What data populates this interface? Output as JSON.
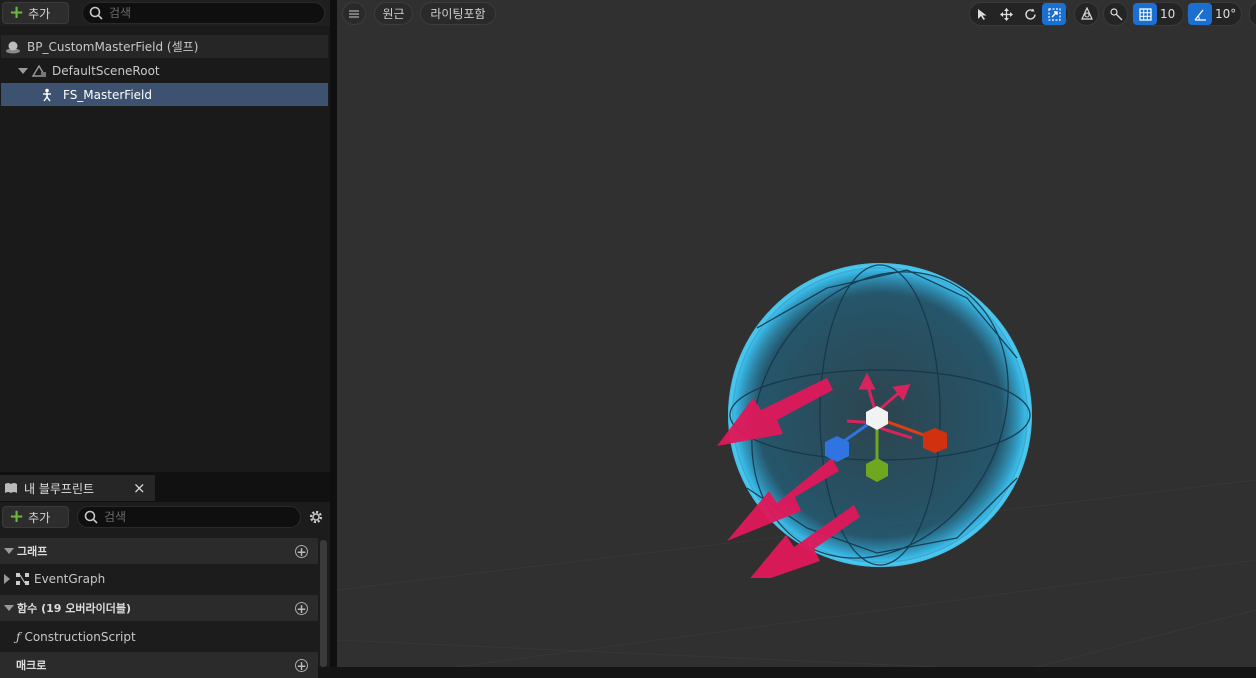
{
  "components": {
    "add_label": "추가",
    "search_placeholder": "검색",
    "tree": [
      {
        "label": "BP_CustomMasterField (셀프)"
      },
      {
        "label": "DefaultSceneRoot"
      },
      {
        "label": "FS_MasterField"
      }
    ]
  },
  "my_blueprint": {
    "tab_label": "내 블루프린트",
    "close_glyph": "×",
    "add_label": "추가",
    "search_placeholder": "검색",
    "categories": {
      "graphs": "그래프",
      "functions": "함수 (19 오버라이더블)",
      "macros": "매크로"
    },
    "items": {
      "event_graph": "EventGraph",
      "construction_script": "ConstructionScript"
    }
  },
  "viewport": {
    "perspective_label": "원근",
    "lighting_label": "라이팅포함",
    "grid_snap_value": "10",
    "rotation_snap_value": "10°"
  },
  "colors": {
    "selection": "#3d5271",
    "accent": "#1a6fd1",
    "add_green": "#6bbb3a"
  }
}
